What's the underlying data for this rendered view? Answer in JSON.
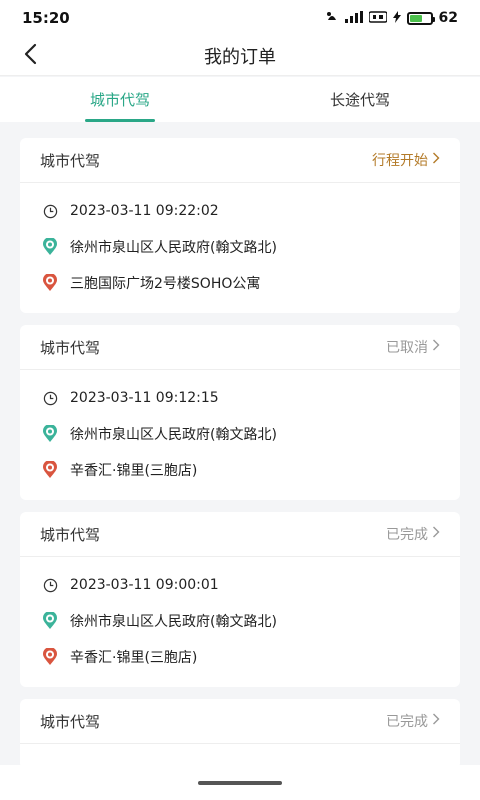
{
  "status_bar": {
    "time": "15:20",
    "battery": "62",
    "battery_level_percent": 62
  },
  "nav": {
    "title": "我的订单"
  },
  "tabs": [
    {
      "label": "城市代驾",
      "active": true
    },
    {
      "label": "长途代驾",
      "active": false
    }
  ],
  "orders": [
    {
      "type": "城市代驾",
      "status": "行程开始",
      "time": "2023-03-11 09:22:02",
      "from": "徐州市泉山区人民政府(翰文路北)",
      "to": "三胞国际广场2号楼SOHO公寓"
    },
    {
      "type": "城市代驾",
      "status": "已取消",
      "time": "2023-03-11 09:12:15",
      "from": "徐州市泉山区人民政府(翰文路北)",
      "to": "辛香汇·锦里(三胞店)"
    },
    {
      "type": "城市代驾",
      "status": "已完成",
      "time": "2023-03-11 09:00:01",
      "from": "徐州市泉山区人民政府(翰文路北)",
      "to": "辛香汇·锦里(三胞店)"
    },
    {
      "type": "城市代驾",
      "status": "已完成"
    }
  ],
  "colors": {
    "accent": "#2aa787",
    "in_progress": "#b37a28",
    "muted": "#999999",
    "start_pin": "#3bb39a",
    "end_pin": "#d9553f"
  },
  "icons": {
    "back": "chevron-left-icon",
    "time": "clock-icon",
    "start": "start-pin-icon",
    "end": "end-pin-icon",
    "more": "chevron-right-icon"
  }
}
